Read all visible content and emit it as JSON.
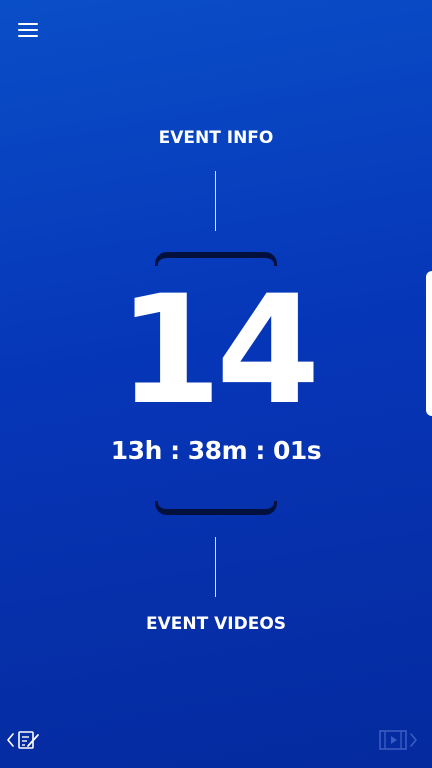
{
  "header": {
    "menu_icon": "hamburger-menu-icon"
  },
  "nav": {
    "event_info_label": "EVENT INFO",
    "event_videos_label": "EVENT VIDEOS"
  },
  "countdown": {
    "days": "14",
    "time": "13h : 38m : 01s"
  },
  "footer": {
    "left_icon": "chevron-left-edit-icon",
    "right_icon": "video-chevron-right-icon"
  },
  "colors": {
    "background_top": "#0a4ec7",
    "background_bottom": "#052a9e",
    "phone_frame": "#02103d",
    "text": "#ffffff"
  }
}
